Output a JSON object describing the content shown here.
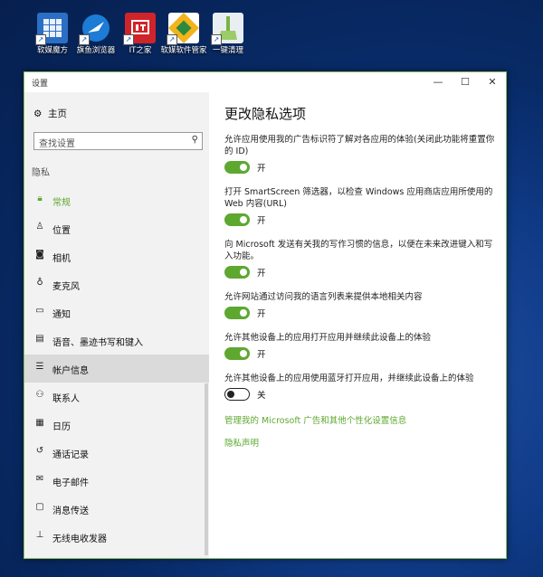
{
  "desktop_icons": [
    {
      "label": "软媒魔方",
      "icon": "rubik-cube-icon",
      "color": "#2b6fc4"
    },
    {
      "label": "旗鱼浏览器",
      "icon": "swordfish-browser-icon",
      "color": "#1c7cd6"
    },
    {
      "label": "IT之家",
      "icon": "ithome-logo-icon",
      "color": "#d0242b"
    },
    {
      "label": "软媒软件管家",
      "icon": "software-manager-icon",
      "color": "#f3b31b"
    },
    {
      "label": "一键清理",
      "icon": "broom-clean-icon",
      "color": "#7cb342"
    }
  ],
  "window": {
    "title": "设置",
    "controls": {
      "minimize": "—",
      "maximize": "☐",
      "close": "✕"
    }
  },
  "sidebar": {
    "home_label": "主页",
    "search_placeholder": "查找设置",
    "section_label": "隐私",
    "accent_color": "#5ea830",
    "items": [
      {
        "label": "常规",
        "icon": "lock-icon",
        "active": true
      },
      {
        "label": "位置",
        "icon": "location-person-icon"
      },
      {
        "label": "相机",
        "icon": "camera-icon"
      },
      {
        "label": "麦克风",
        "icon": "microphone-icon"
      },
      {
        "label": "通知",
        "icon": "notification-icon"
      },
      {
        "label": "语音、墨迹书写和键入",
        "icon": "clipboard-icon"
      },
      {
        "label": "帐户信息",
        "icon": "account-info-icon",
        "hover": true
      },
      {
        "label": "联系人",
        "icon": "contacts-icon"
      },
      {
        "label": "日历",
        "icon": "calendar-icon"
      },
      {
        "label": "通话记录",
        "icon": "history-icon"
      },
      {
        "label": "电子邮件",
        "icon": "mail-icon"
      },
      {
        "label": "消息传送",
        "icon": "message-icon"
      },
      {
        "label": "无线电收发器",
        "icon": "radio-tower-icon"
      }
    ]
  },
  "main": {
    "title": "更改隐私选项",
    "options": [
      {
        "desc": "允许应用使用我的广告标识符了解对各应用的体验(关闭此功能将重置你的 ID)",
        "state": "开",
        "on": true
      },
      {
        "desc": "打开 SmartScreen 筛选器，以检查 Windows 应用商店应用所使用的 Web 内容(URL)",
        "state": "开",
        "on": true
      },
      {
        "desc": "向 Microsoft 发送有关我的写作习惯的信息，以便在未来改进键入和写入功能。",
        "state": "开",
        "on": true
      },
      {
        "desc": "允许网站通过访问我的语言列表来提供本地相关内容",
        "state": "开",
        "on": true
      },
      {
        "desc": "允许其他设备上的应用打开应用并继续此设备上的体验",
        "state": "开",
        "on": true
      },
      {
        "desc": "允许其他设备上的应用使用蓝牙打开应用，并继续此设备上的体验",
        "state": "关",
        "on": false
      }
    ],
    "links": [
      "管理我的 Microsoft 广告和其他个性化设置信息",
      "隐私声明"
    ]
  }
}
